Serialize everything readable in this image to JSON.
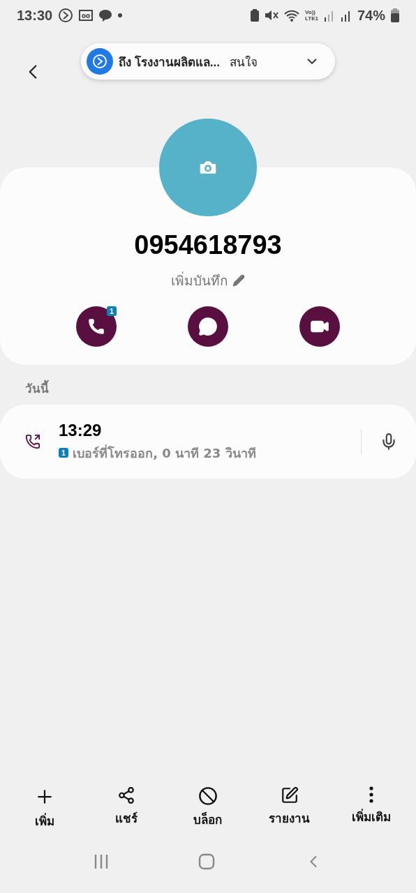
{
  "status_bar": {
    "time": "13:30",
    "network": "Vo))\nLTE1",
    "battery": "74%"
  },
  "notification": {
    "title": "ถึง โรงงานผลิตแล...",
    "action": "สนใจ"
  },
  "contact": {
    "number": "0954618793",
    "note": "เพิ่มบันทึก"
  },
  "actions": [
    {
      "kind": "call",
      "badge": "1"
    },
    {
      "kind": "message"
    },
    {
      "kind": "video"
    }
  ],
  "section": "วันนี้",
  "calls": [
    {
      "time": "13:29",
      "sim": "1",
      "description": "เบอร์ที่โทรออก, 0 นาที 23 วินาที"
    }
  ],
  "bottom_actions": [
    {
      "kind": "add",
      "label": "เพิ่ม"
    },
    {
      "kind": "share",
      "label": "แชร์"
    },
    {
      "kind": "block",
      "label": "บล็อก"
    },
    {
      "kind": "report",
      "label": "รายงาน"
    },
    {
      "kind": "more",
      "label": "เพิ่มเติม"
    }
  ]
}
